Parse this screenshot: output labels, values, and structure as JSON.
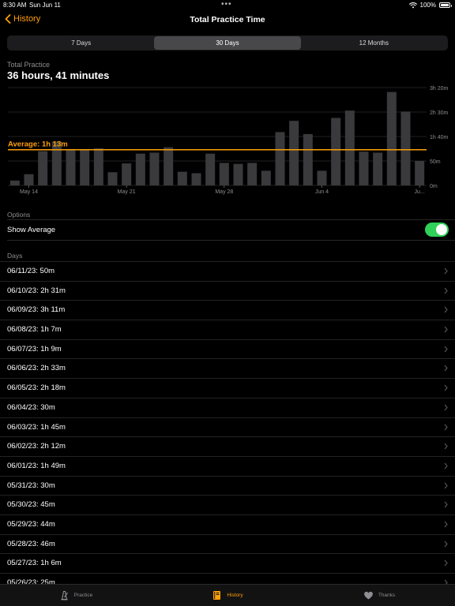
{
  "status": {
    "time": "8:30 AM",
    "date": "Sun Jun 11",
    "battery": "100%"
  },
  "nav": {
    "back_label": "History",
    "title": "Total Practice Time"
  },
  "segments": [
    {
      "label": "7 Days",
      "active": false
    },
    {
      "label": "30 Days",
      "active": true
    },
    {
      "label": "12 Months",
      "active": false
    }
  ],
  "summary": {
    "caption": "Total Practice",
    "value": "36 hours, 41 minutes"
  },
  "chart_data": {
    "type": "bar",
    "categories": [
      "05/13/23",
      "05/14/23",
      "05/15/23",
      "05/16/23",
      "05/17/23",
      "05/18/23",
      "05/19/23",
      "05/20/23",
      "05/21/23",
      "05/22/23",
      "05/23/23",
      "05/24/23",
      "05/25/23",
      "05/26/23",
      "05/27/23",
      "05/28/23",
      "05/29/23",
      "05/30/23",
      "05/31/23",
      "06/01/23",
      "06/02/23",
      "06/03/23",
      "06/04/23",
      "06/05/23",
      "06/06/23",
      "06/07/23",
      "06/08/23",
      "06/09/23",
      "06/10/23",
      "06/11/23"
    ],
    "values": [
      10,
      23,
      70,
      90,
      72,
      72,
      76,
      27,
      45,
      65,
      67,
      78,
      28,
      25,
      65,
      46,
      44,
      46,
      30,
      109,
      132,
      105,
      30,
      138,
      153,
      69,
      67,
      191,
      151,
      50
    ],
    "y_unit": "minutes",
    "ylim": [
      0,
      200
    ],
    "y_ticks": [
      {
        "value": 0,
        "label": "0m"
      },
      {
        "value": 50,
        "label": "50m"
      },
      {
        "value": 100,
        "label": "1h 40m"
      },
      {
        "value": 150,
        "label": "2h 30m"
      },
      {
        "value": 200,
        "label": "3h 20m"
      }
    ],
    "x_ticks": [
      {
        "index": 1,
        "label": "May 14"
      },
      {
        "index": 8,
        "label": "May 21"
      },
      {
        "index": 15,
        "label": "May 28"
      },
      {
        "index": 22,
        "label": "Jun 4"
      },
      {
        "index": 29,
        "label": "Ju..."
      }
    ],
    "average": {
      "value": 73,
      "label": "Average: 1h 13m"
    },
    "colors": {
      "bar": "#3a3a3c",
      "average": "#ff9f0a",
      "grid": "#1f1f21",
      "tick": "#8e8e93"
    }
  },
  "options": {
    "header": "Options",
    "show_average_label": "Show Average",
    "show_average_on": true
  },
  "days": {
    "header": "Days",
    "items": [
      "06/11/23: 50m",
      "06/10/23: 2h 31m",
      "06/09/23: 3h 11m",
      "06/08/23: 1h 7m",
      "06/07/23: 1h 9m",
      "06/06/23: 2h 33m",
      "06/05/23: 2h 18m",
      "06/04/23: 30m",
      "06/03/23: 1h 45m",
      "06/02/23: 2h 12m",
      "06/01/23: 1h 49m",
      "05/31/23: 30m",
      "05/30/23: 45m",
      "05/29/23: 44m",
      "05/28/23: 46m",
      "05/27/23: 1h 6m",
      "05/26/23: 25m"
    ]
  },
  "tabs": [
    {
      "name": "practice",
      "label": "Practice",
      "icon": "metronome-icon",
      "active": false
    },
    {
      "name": "history",
      "label": "History",
      "icon": "book-icon",
      "active": true
    },
    {
      "name": "thanks",
      "label": "Thanks",
      "icon": "heart-icon",
      "active": false
    }
  ],
  "accent": "#ff9f0a",
  "toggle_color": "#30d158"
}
